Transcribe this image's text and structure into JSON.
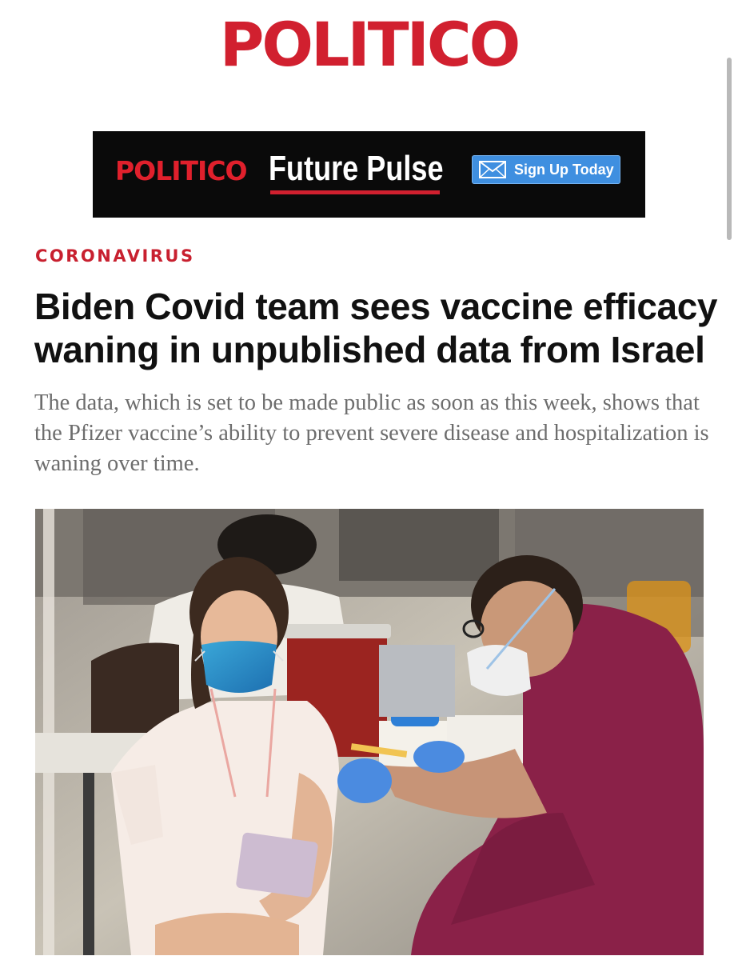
{
  "header": {
    "logo_text": "POLITICO",
    "brand_color": "#d1202f"
  },
  "ad_banner": {
    "logo_text": "POLITICO",
    "product_name": "Future Pulse",
    "button_label": "Sign Up Today",
    "button_icon": "envelope-icon",
    "background_color": "#0a0a0a",
    "button_color": "#3f8fe0"
  },
  "article": {
    "category": "CORONAVIRUS",
    "headline": "Biden Covid team sees vaccine efficacy waning in unpublished data from Israel",
    "dek": "The data, which is set to be made public as soon as this week, shows that the Pfizer vaccine’s ability to prevent severe disease and hospitalization is waning over time."
  },
  "photo": {
    "subject": "A health worker in maroon scrubs and a face mask gives a vaccine injection to a girl wearing a blue face mask"
  }
}
